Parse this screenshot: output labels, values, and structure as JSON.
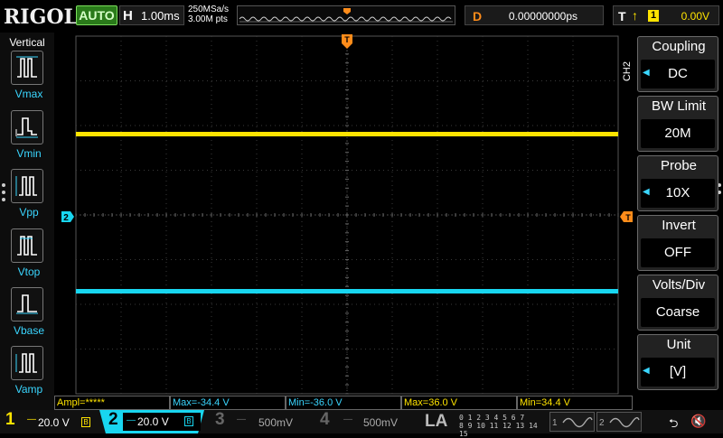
{
  "topbar": {
    "brand": "RIGOL",
    "run_status": "AUTO",
    "horizontal_letter": "H",
    "timebase": "1.00ms",
    "sample_rate": "250MSa/s",
    "memory_depth": "3.00M pts",
    "delay_letter": "D",
    "delay": "0.00000000ps",
    "trigger_letter": "T",
    "trigger_source": "1",
    "trigger_level": "0.00V"
  },
  "left_panel": {
    "title": "Vertical",
    "measurements": [
      {
        "label": "Vmax",
        "icon": "vmax-icon"
      },
      {
        "label": "Vmin",
        "icon": "vmin-icon"
      },
      {
        "label": "Vpp",
        "icon": "vpp-icon"
      },
      {
        "label": "Vtop",
        "icon": "vtop-icon"
      },
      {
        "label": "Vbase",
        "icon": "vbase-icon"
      },
      {
        "label": "Vamp",
        "icon": "vamp-icon"
      }
    ]
  },
  "grid": {
    "ch1_marker": "",
    "ch2_marker": "2",
    "trigger_pos_marker": "T",
    "trigger_level_marker": "T"
  },
  "right_panel": {
    "channel": "CH2",
    "menus": [
      {
        "title": "Coupling",
        "value": "DC",
        "has_arrow": true
      },
      {
        "title": "BW Limit",
        "value": "20M",
        "has_arrow": false
      },
      {
        "title": "Probe",
        "value": "10X",
        "has_arrow": true
      },
      {
        "title": "Invert",
        "value": "OFF",
        "has_arrow": false
      },
      {
        "title": "Volts/Div",
        "value": "Coarse",
        "has_arrow": false
      },
      {
        "title": "Unit",
        "value": "[V]",
        "has_arrow": true
      }
    ]
  },
  "measurement_bar": [
    {
      "text": "Ampl=*****",
      "color": "yellow"
    },
    {
      "text": "Max=-34.4 V",
      "color": "cyan"
    },
    {
      "text": "Min=-36.0 V",
      "color": "cyan"
    },
    {
      "text": "Max=36.0 V",
      "color": "yellow"
    },
    {
      "text": "Min=34.4 V",
      "color": "yellow"
    }
  ],
  "bottombar": {
    "ch1": {
      "num": "1",
      "scale": "20.0 V"
    },
    "ch2": {
      "num": "2",
      "scale": "20.0 V"
    },
    "ch3": {
      "num": "3",
      "scale": "500mV"
    },
    "ch4": {
      "num": "4",
      "scale": "500mV"
    },
    "la": "LA",
    "la_digits_row1": "0 1 2 3   4 5 6 7",
    "la_digits_row2": "8 9 10 11  12 13 14 15",
    "gen1": "1",
    "gen2": "2"
  },
  "colors": {
    "ch1": "#ffe400",
    "ch2": "#18d6f0",
    "ch3": "#e000e0",
    "ch4": "#2a6cff",
    "trigger": "#ff8c1a"
  }
}
